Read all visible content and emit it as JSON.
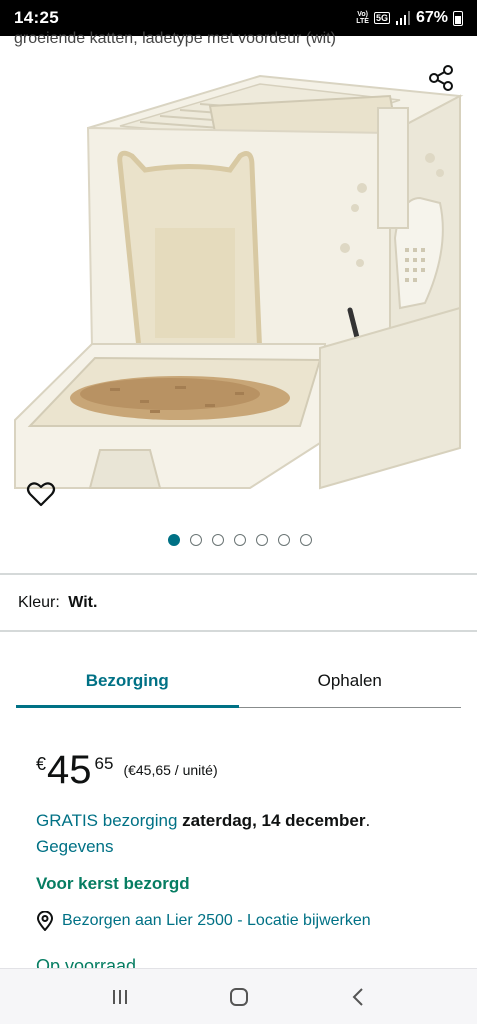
{
  "status_bar": {
    "time": "14:25",
    "network_top": "Vo)",
    "network_bottom": "LTE",
    "network_type": "5G",
    "battery": "67%"
  },
  "product": {
    "subtitle": "groeiende katten, ladetype met voordeur (wit)",
    "image_description_icon": "cat-litter-box-image",
    "gallery_total": 7,
    "gallery_active_index": 0
  },
  "color": {
    "label": "Kleur:",
    "value": "Wit."
  },
  "tabs": [
    {
      "label": "Bezorging",
      "active": true
    },
    {
      "label": "Ophalen",
      "active": false
    }
  ],
  "price": {
    "symbol": "€",
    "whole": "45",
    "fraction": "65",
    "unit_price": "(€45,65 / unité)"
  },
  "delivery": {
    "free_label": "GRATIS bezorging",
    "date": "zaterdag, 14 december",
    "period": ".",
    "details_link": "Gegevens"
  },
  "christmas": "Voor kerst bezorgd",
  "location": {
    "text": "Bezorgen aan Lier 2500 - Locatie bijwerken"
  },
  "stock": "Op voorraad",
  "colors": {
    "accent": "#007185",
    "green": "#067d62"
  }
}
